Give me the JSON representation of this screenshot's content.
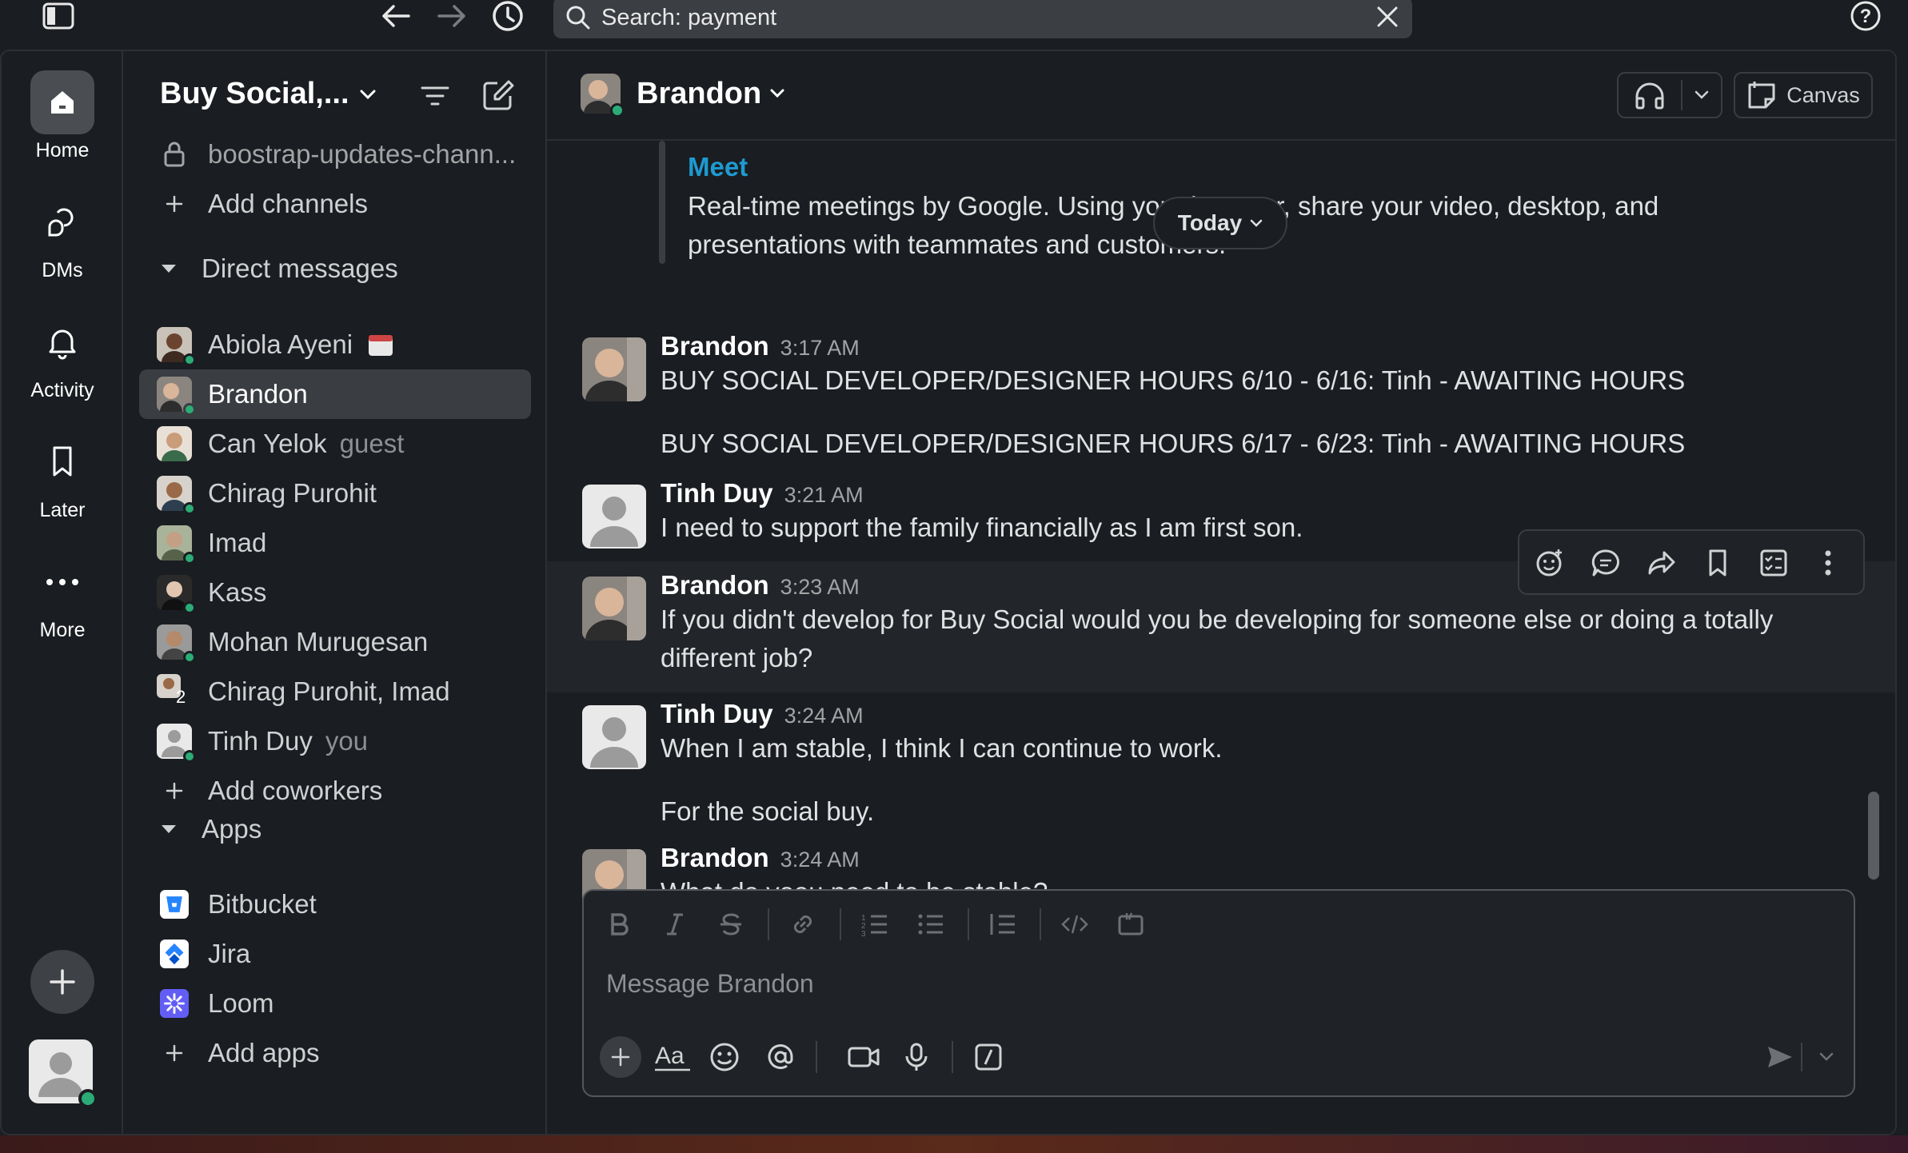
{
  "search": {
    "text": "Search: payment"
  },
  "workspace": {
    "name": "Buy Social,..."
  },
  "rail": {
    "home": "Home",
    "dms": "DMs",
    "activity": "Activity",
    "later": "Later",
    "more": "More"
  },
  "sidebar": {
    "channel": "boostrap-updates-chann...",
    "add_channels": "Add channels",
    "dm_section": "Direct messages",
    "dms": [
      {
        "name": "Abiola Ayeni",
        "sub": ""
      },
      {
        "name": "Brandon",
        "sub": ""
      },
      {
        "name": "Can Yelok",
        "sub": "guest"
      },
      {
        "name": "Chirag Purohit",
        "sub": ""
      },
      {
        "name": "Imad",
        "sub": ""
      },
      {
        "name": "Kass",
        "sub": ""
      },
      {
        "name": "Mohan Murugesan",
        "sub": ""
      },
      {
        "name": "Chirag Purohit, Imad",
        "sub": "",
        "badge": "2"
      },
      {
        "name": "Tinh Duy",
        "sub": "you"
      }
    ],
    "add_coworkers": "Add coworkers",
    "apps_section": "Apps",
    "apps": [
      "Bitbucket",
      "Jira",
      "Loom"
    ],
    "add_apps": "Add apps"
  },
  "header": {
    "title": "Brandon",
    "canvas": "Canvas"
  },
  "messages": {
    "preview_title": "Meet",
    "preview_text_1": "Real-time meetings by Google. Using your browser, share your video, desktop, and",
    "preview_text_2": "presentations with teammates and customers.",
    "today": "Today",
    "items": [
      {
        "author": "Brandon",
        "time": "3:17 AM",
        "lines": [
          "BUY SOCIAL DEVELOPER/DESIGNER HOURS 6/10 - 6/16: Tinh - AWAITING HOURS"
        ]
      },
      {
        "cont": "BUY SOCIAL DEVELOPER/DESIGNER HOURS 6/17 - 6/23: Tinh - AWAITING HOURS"
      },
      {
        "author": "Tinh Duy",
        "time": "3:21 AM",
        "lines": [
          "I need to support the family financially as I am first son."
        ]
      },
      {
        "author": "Brandon",
        "time": "3:23 AM",
        "lines": [
          "If you didn't develop for Buy Social would you be developing for someone else or doing a totally",
          "different job?"
        ]
      },
      {
        "author": "Tinh Duy",
        "time": "3:24 AM",
        "lines": [
          "When I am stable, I think I can continue to work."
        ]
      },
      {
        "cont": "For the social buy."
      },
      {
        "author": "Brandon",
        "time": "3:24 AM",
        "lines": [
          "What do yoou need to be stable?"
        ]
      }
    ]
  },
  "composer": {
    "placeholder": "Message Brandon"
  },
  "colors": {
    "accent_green": "#2bac76",
    "link": "#1d9bd1",
    "active_row": "#3a3d42"
  }
}
